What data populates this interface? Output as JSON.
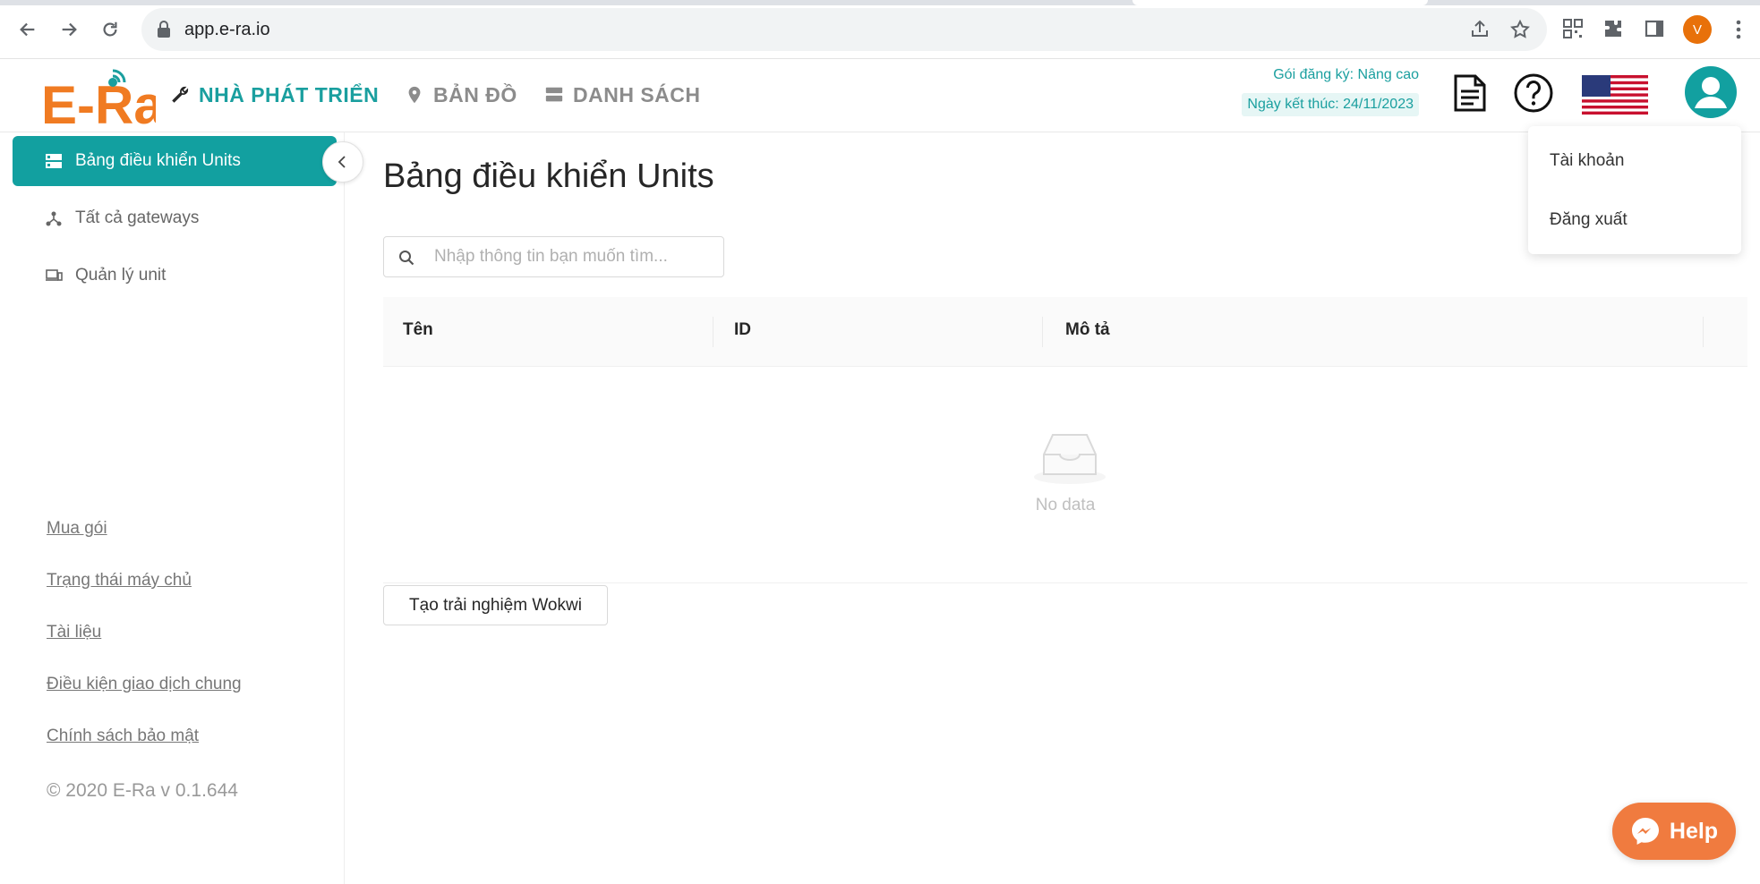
{
  "browser": {
    "url": "app.e-ra.io",
    "profile_initial": "V"
  },
  "header": {
    "nav": [
      {
        "label": "NHÀ PHÁT TRIỂN",
        "icon": "wrench-icon",
        "active": true
      },
      {
        "label": "BẢN ĐỒ",
        "icon": "map-pin-icon",
        "active": false
      },
      {
        "label": "DANH SÁCH",
        "icon": "list-icon",
        "active": false
      }
    ],
    "subscription_plan": "Gói đăng ký: Nâng cao",
    "end_date": "Ngày kết thúc: 24/11/2023"
  },
  "sidebar": {
    "items": [
      {
        "label": "Bảng điều khiển Units",
        "icon": "dashboard-icon",
        "active": true
      },
      {
        "label": "Tất cả gateways",
        "icon": "gateway-icon",
        "active": false
      },
      {
        "label": "Quản lý unit",
        "icon": "devices-icon",
        "active": false
      }
    ],
    "links": [
      "Mua gói",
      "Trạng thái máy chủ",
      "Tài liệu",
      "Điều kiện giao dịch chung",
      "Chính sách bảo mật"
    ],
    "copyright": "© 2020 E-Ra v 0.1.644"
  },
  "main": {
    "title": "Bảng điều khiển Units",
    "search_placeholder": "Nhập thông tin bạn muốn tìm...",
    "columns": [
      "Tên",
      "ID",
      "Mô tả"
    ],
    "empty_text": "No data",
    "wokwi_button": "Tạo trải nghiệm Wokwi"
  },
  "dropdown": {
    "items": [
      "Tài khoản",
      "Đăng xuất"
    ]
  },
  "help_button": "Help",
  "colors": {
    "brand_teal": "#12a0a0",
    "brand_orange": "#f07b3f",
    "muted_nav": "#8c8c8c"
  }
}
